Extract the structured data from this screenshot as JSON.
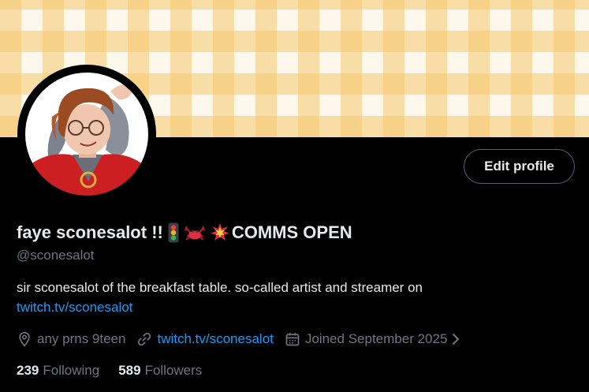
{
  "profile": {
    "display_name": "faye sconesalot !!",
    "name_emojis": [
      "traffic-light",
      "crab",
      "collision"
    ],
    "name_suffix": "COMMS OPEN",
    "handle": "@sconesalot",
    "bio_text": "sir sconesalot of the breakfast table. so-called artist and streamer on",
    "bio_link": "twitch.tv/sconesalot",
    "location": "any prns 9teen",
    "website": "twitch.tv/sconesalot",
    "joined": "Joined September 2025",
    "following_count": "239",
    "following_label": "Following",
    "followers_count": "589",
    "followers_label": "Followers"
  },
  "actions": {
    "edit_profile_label": "Edit profile"
  },
  "icons": {
    "location": "location-pin-icon",
    "website": "link-icon",
    "joined": "calendar-icon",
    "joined_more": "chevron-right-icon"
  },
  "colors": {
    "background": "#000000",
    "text_primary": "#e7e9ea",
    "text_secondary": "#71767b",
    "link": "#1d9bf0",
    "button_border": "#536471",
    "banner_base": "#fdf7ec",
    "banner_stripe": "#f5c86e"
  }
}
